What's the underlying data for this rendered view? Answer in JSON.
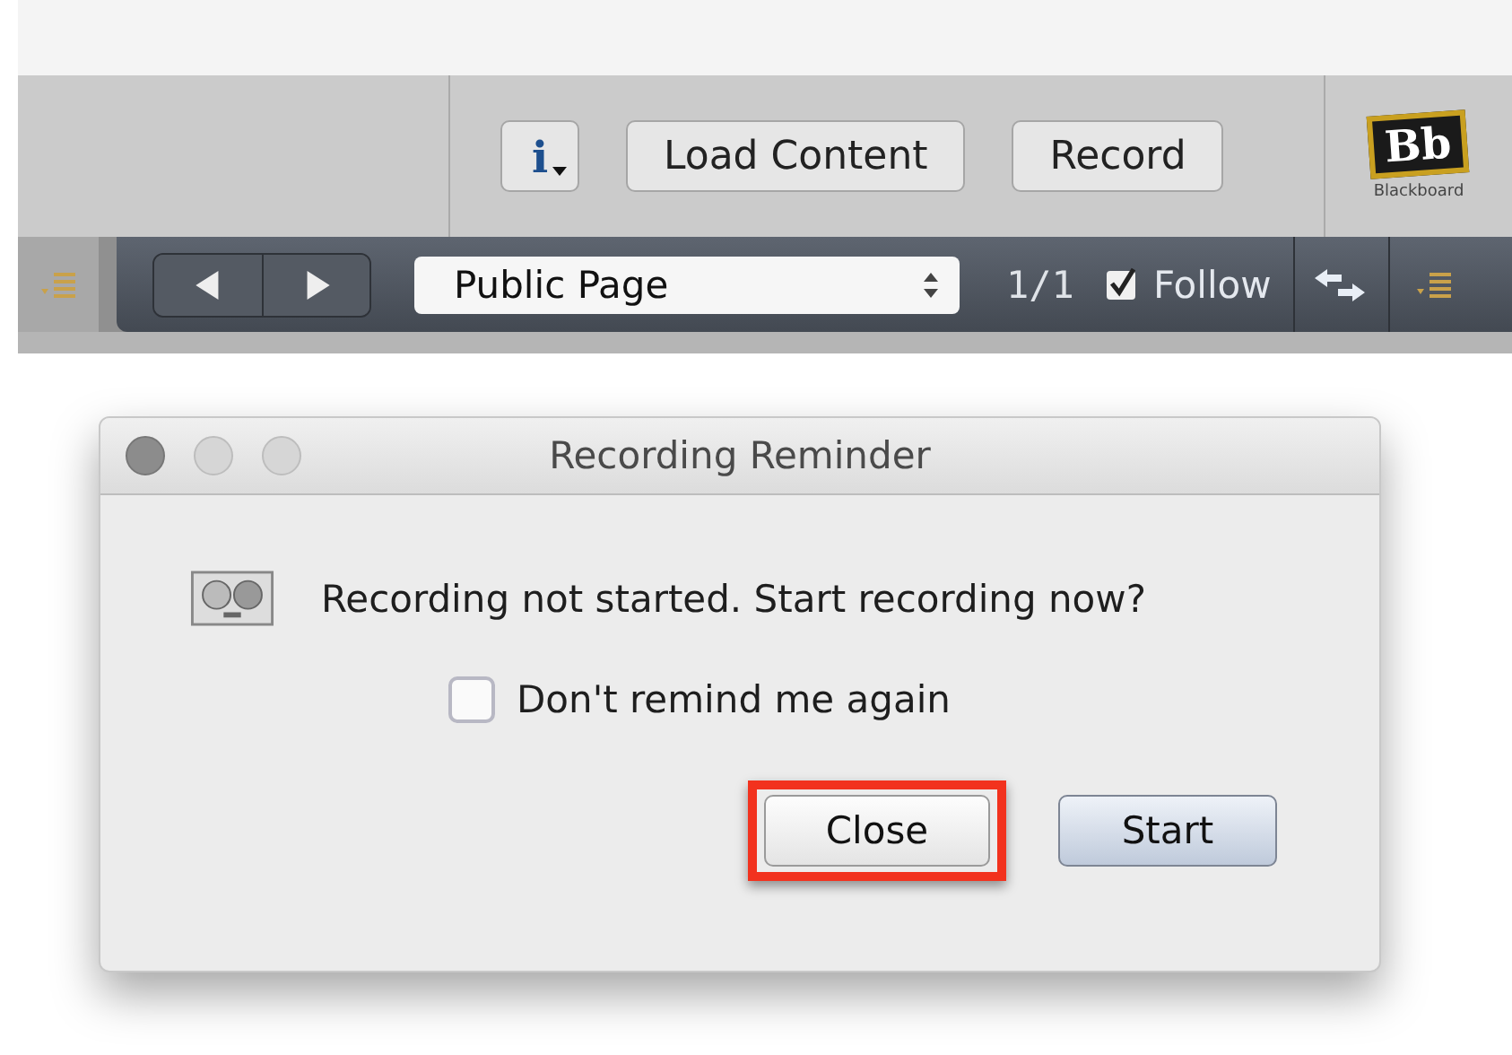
{
  "toolbar": {
    "info_button": "i",
    "buttons": [
      "Load Content",
      "Record"
    ],
    "logo": {
      "mark": "Bb",
      "caption": "Blackboard"
    }
  },
  "navbar": {
    "page_select": "Public Page",
    "page_count": "1/1",
    "follow": {
      "label": "Follow",
      "checked": true
    }
  },
  "dialog": {
    "title": "Recording Reminder",
    "message": "Recording not started. Start recording now?",
    "checkbox": {
      "label": "Don't remind me again",
      "checked": false
    },
    "buttons": [
      {
        "label": "Close",
        "default": false,
        "highlighted": true
      },
      {
        "label": "Start",
        "default": true,
        "highlighted": false
      }
    ]
  }
}
